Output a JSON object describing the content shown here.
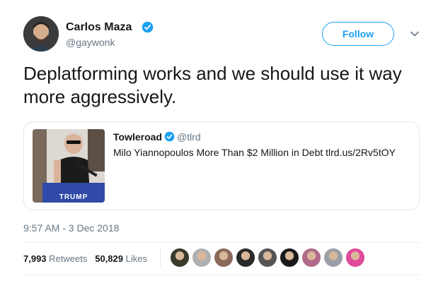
{
  "author": {
    "name": "Carlos Maza",
    "handle": "@gaywonk",
    "avatar_icon": "user-avatar"
  },
  "follow_label": "Follow",
  "tweet_text": "Deplatforming works and we should use it way more aggressively.",
  "quoted": {
    "name": "Towleroad",
    "handle": "@tlrd",
    "text": "Milo Yiannopoulos More Than $2 Million in Debt tlrd.us/2Rv5tOY",
    "image_sign_text": "TRUMP"
  },
  "timestamp": "9:57 AM - 3 Dec 2018",
  "stats": {
    "retweets_count": "7,993",
    "retweets_label": "Retweets",
    "likes_count": "50,829",
    "likes_label": "Likes"
  },
  "colors": {
    "accent": "#1da1f2",
    "muted": "#657786",
    "text": "#14171a",
    "border": "#e1e8ed"
  },
  "likers": [
    "#3a3a2a",
    "#b0b0b0",
    "#8a6a5a",
    "#2a2a2a",
    "#555555",
    "#1a1a1a",
    "#b06a8a",
    "#9aa0a6",
    "#e04a9a"
  ]
}
